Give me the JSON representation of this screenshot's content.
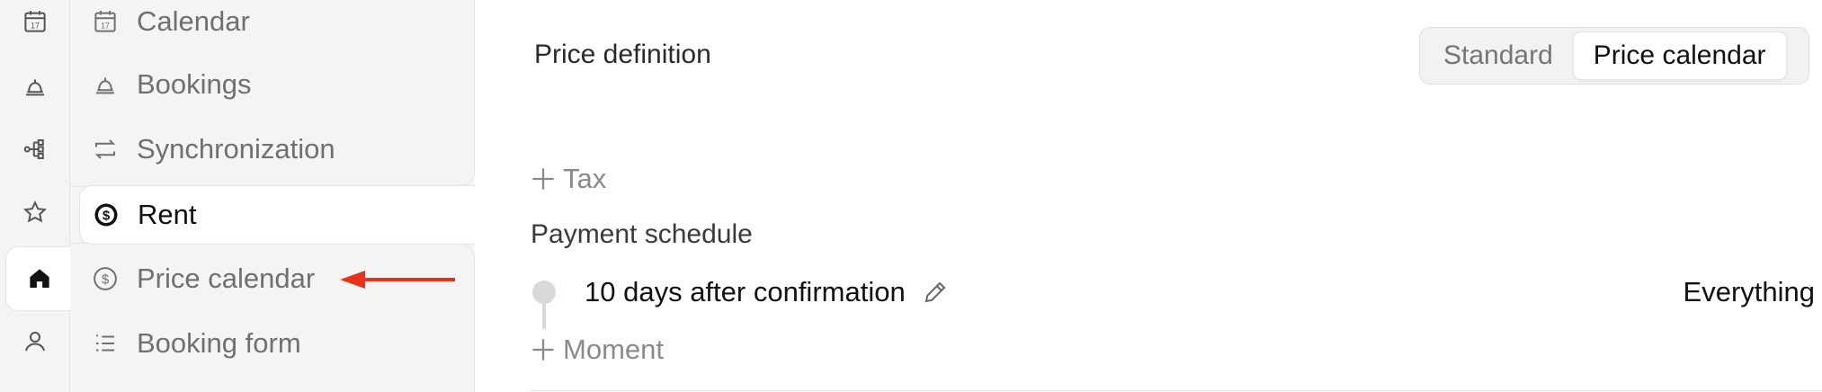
{
  "rail": {
    "items": [
      {
        "name": "calendar-icon"
      },
      {
        "name": "bell-icon"
      },
      {
        "name": "flow-icon"
      },
      {
        "name": "star-icon"
      },
      {
        "name": "home-icon",
        "active": true
      },
      {
        "name": "user-icon"
      }
    ]
  },
  "sidebar": {
    "items": [
      {
        "label": "Calendar",
        "icon": "calendar-icon"
      },
      {
        "label": "Bookings",
        "icon": "bell-icon"
      },
      {
        "label": "Synchronization",
        "icon": "sync-icon"
      },
      {
        "label": "Rent",
        "icon": "dollar-circle-icon",
        "active": true
      },
      {
        "label": "Price calendar",
        "icon": "dollar-circle-icon"
      },
      {
        "label": "Booking form",
        "icon": "list-icon"
      }
    ]
  },
  "annotation": {
    "arrow_color": "#e8321c"
  },
  "main": {
    "price_definition_label": "Price definition",
    "toggle": {
      "options": [
        "Standard",
        "Price calendar"
      ],
      "selected": "Price calendar"
    },
    "add_tax_label": "Tax",
    "payment_schedule_title": "Payment schedule",
    "moments": [
      {
        "label": "10 days after confirmation",
        "amount": "Everything"
      }
    ],
    "add_moment_label": "Moment"
  }
}
